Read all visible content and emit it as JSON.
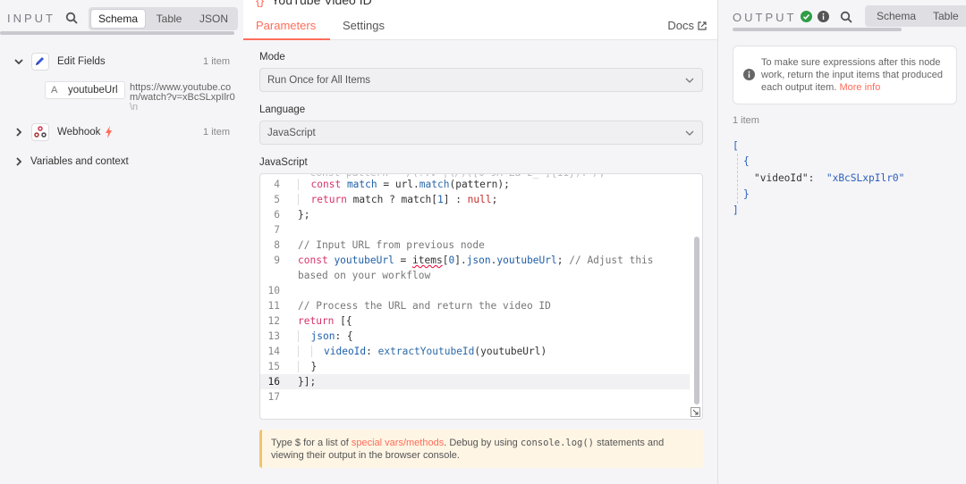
{
  "input": {
    "title": "INPUT",
    "tabs": [
      "Schema",
      "Table",
      "JSON"
    ],
    "tree": [
      {
        "label": "Edit Fields",
        "count": "1 item"
      },
      {
        "label": "Webhook",
        "count": "1 item"
      },
      {
        "label": "Variables and context"
      }
    ],
    "field": {
      "type": "A",
      "name": "youtubeUrl",
      "value": "https://www.youtube.com/watch?v=xBcSLxpIlr0",
      "newline": "\\n"
    }
  },
  "node": {
    "title": "YouTube Video ID",
    "tabs": [
      "Parameters",
      "Settings"
    ],
    "docs": "Docs",
    "mode_label": "Mode",
    "mode_value": "Run Once for All Items",
    "language_label": "Language",
    "language_value": "JavaScript",
    "code_label": "JavaScript",
    "line_numbers": [
      "4",
      "5",
      "6",
      "7",
      "8",
      "9",
      "",
      "10",
      "11",
      "12",
      "13",
      "14",
      "15",
      "16",
      "17"
    ],
    "hint": {
      "p1": "Type $ for a list of ",
      "link": "special vars/methods",
      "p2": ". Debug by using ",
      "code": "console.log()",
      "p3": " statements and viewing their output in the browser console."
    }
  },
  "output": {
    "title": "OUTPUT",
    "tabs": [
      "Schema",
      "Table"
    ],
    "notice": "To make sure expressions after this node work, return the input items that produced each output item.",
    "notice_link": "More info",
    "item_count": "1 item",
    "json_key": "\"videoId\"",
    "json_value": "\"xBcSLxpIlr0\""
  },
  "colors": {
    "accent": "#ff6d5a",
    "success": "#2f9e44"
  }
}
